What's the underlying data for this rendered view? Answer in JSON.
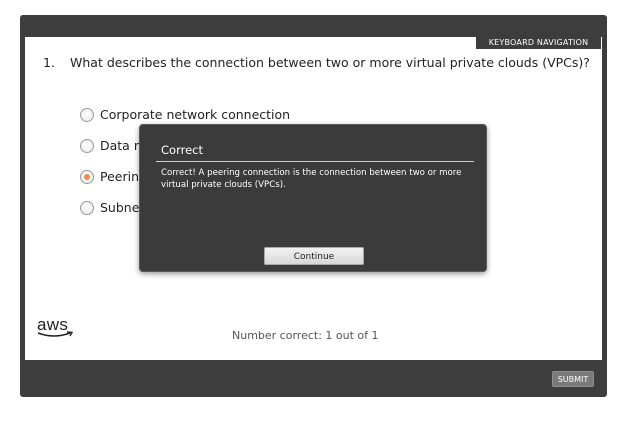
{
  "toolbar": {
    "keyboard_navigation_label": "KEYBOARD NAVIGATION",
    "submit_label": "SUBMIT"
  },
  "question": {
    "number": "1.",
    "text": "What describes the connection between two or more virtual private clouds (VPCs)?",
    "options": [
      {
        "label": "Corporate network connection",
        "selected": false
      },
      {
        "label": "Data n",
        "selected": false
      },
      {
        "label": "Peerin",
        "selected": true
      },
      {
        "label": "Subne",
        "selected": false
      }
    ]
  },
  "logo": {
    "text": "aws"
  },
  "score": {
    "text": "Number correct: 1 out of 1"
  },
  "dialog": {
    "title": "Correct",
    "message": "Correct! A peering connection is the connection between two or more virtual private clouds (VPCs).",
    "continue_label": "Continue"
  },
  "colors": {
    "frame": "#3d3d3d",
    "selected_radio": "#f08a4b",
    "dialog_bg": "#3b3b3b"
  }
}
